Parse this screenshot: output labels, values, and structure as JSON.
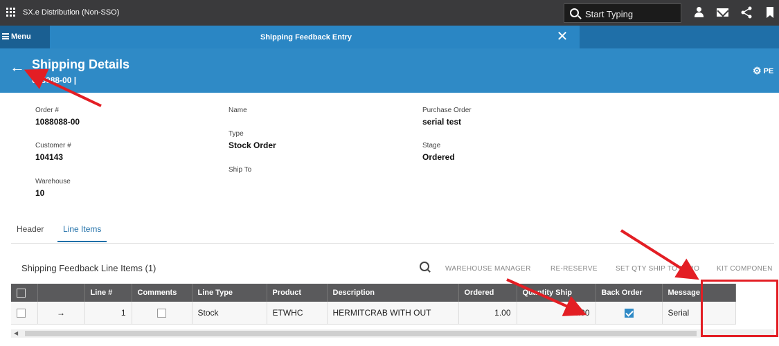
{
  "topbar": {
    "app_title": "SX.e Distribution (Non-SSO)",
    "search_placeholder": "Start Typing",
    "icons": [
      "apps-grid-icon",
      "search-icon",
      "person-icon",
      "mail-icon",
      "share-icon",
      "bookmark-icon"
    ]
  },
  "nav": {
    "menu_label": "Menu",
    "tab_title": "Shipping Feedback Entry",
    "close_glyph": "✕"
  },
  "header": {
    "title": "Shipping Details",
    "subtitle": "088088-00 |",
    "right_action": "PE"
  },
  "details": {
    "order_label": "Order #",
    "order_value": "1088088-00",
    "customer_label": "Customer #",
    "customer_value": "104143",
    "warehouse_label": "Warehouse",
    "warehouse_value": "10",
    "name_label": "Name",
    "name_value": "",
    "type_label": "Type",
    "type_value": "Stock Order",
    "shipto_label": "Ship To",
    "shipto_value": "",
    "po_label": "Purchase Order",
    "po_value": "serial test",
    "stage_label": "Stage",
    "stage_value": "Ordered"
  },
  "tabs": {
    "header": "Header",
    "line_items": "Line Items"
  },
  "grid": {
    "title": "Shipping Feedback Line Items (1)",
    "actions": [
      "WAREHOUSE MANAGER",
      "RE-RESERVE",
      "SET QTY SHIP TO ZERO",
      "KIT COMPONEN"
    ],
    "columns": [
      "Line #",
      "Comments",
      "Line Type",
      "Product",
      "Description",
      "Ordered",
      "Quantity Ship",
      "Back Order",
      "Message"
    ],
    "rows": [
      {
        "line": "1",
        "comments_checked": false,
        "line_type": "Stock",
        "product": "ETWHC",
        "description": "HERMITCRAB WITH OUT",
        "ordered": "1.00",
        "qty_ship": "1.00",
        "back_order_checked": true,
        "message": "Serial"
      }
    ]
  },
  "annotation_color": "#e31e24"
}
